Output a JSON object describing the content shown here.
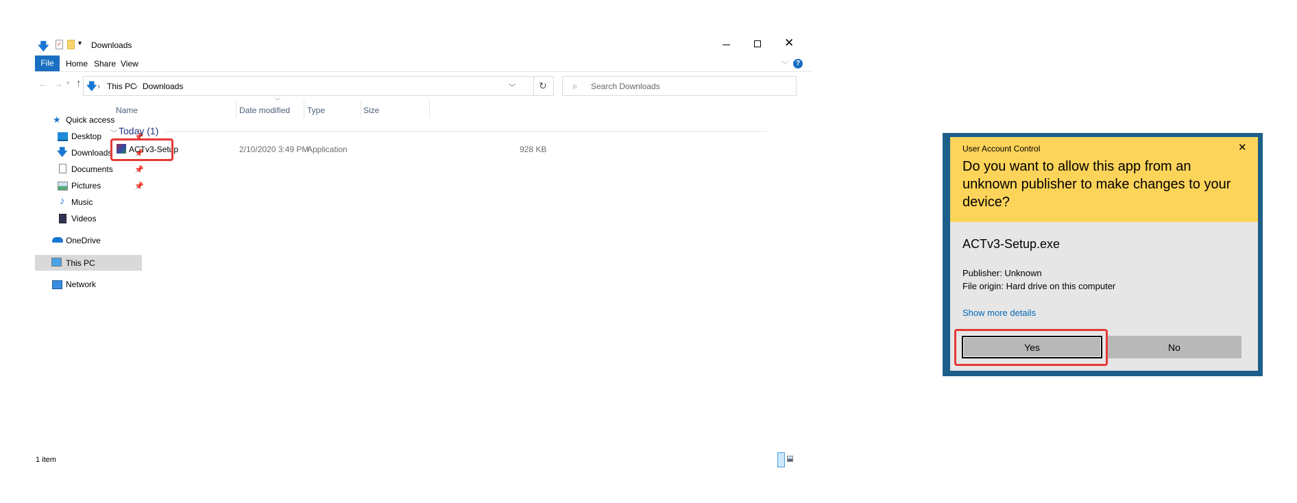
{
  "explorer": {
    "title": "Downloads",
    "ribbon_tabs": [
      "File",
      "Home",
      "Share",
      "View"
    ],
    "breadcrumb": [
      "This PC",
      "Downloads"
    ],
    "search_placeholder": "Search Downloads",
    "columns": [
      "Name",
      "Date modified",
      "Type",
      "Size"
    ],
    "group": "Today (1)",
    "files": [
      {
        "name": "ACTv3-Setup",
        "date": "2/10/2020 3:49 PM",
        "type": "Application",
        "size": "928 KB"
      }
    ],
    "sidebar": {
      "quick_access": "Quick access",
      "pinned": [
        "Desktop",
        "Downloads",
        "Documents",
        "Pictures"
      ],
      "other": [
        "Music",
        "Videos"
      ],
      "onedrive": "OneDrive",
      "this_pc": "This PC",
      "network": "Network"
    },
    "status": "1 item"
  },
  "uac": {
    "caption": "User Account Control",
    "question": "Do you want to allow this app from an unknown publisher to make changes to your device?",
    "filename": "ACTv3-Setup.exe",
    "publisher": "Publisher: Unknown",
    "origin": "File origin: Hard drive on this computer",
    "details_link": "Show more details",
    "yes": "Yes",
    "no": "No"
  },
  "colors": {
    "highlight": "#e53935",
    "uac_header": "#fcd45a",
    "uac_border": "#1c5f8a",
    "link": "#0067b8",
    "file_tab": "#1a6fc1"
  }
}
